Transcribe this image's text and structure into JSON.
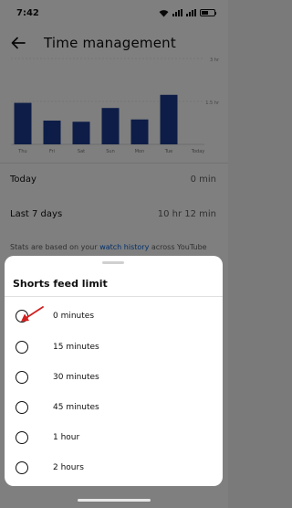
{
  "status_bar": {
    "time": "7:42",
    "icons": [
      "wifi-icon",
      "signal-icon",
      "signal-icon",
      "battery-icon"
    ]
  },
  "header": {
    "title": "Time management",
    "back_icon": "back-arrow-icon"
  },
  "chart_data": {
    "type": "bar",
    "categories": [
      "Thu",
      "Fri",
      "Sat",
      "Sun",
      "Mon",
      "Tue",
      "Today"
    ],
    "values": [
      1.45,
      0.83,
      0.79,
      1.27,
      0.87,
      1.73,
      0
    ],
    "ytick_labels": [
      "3 hr",
      "1.5 hr"
    ],
    "ylim": [
      0,
      3
    ],
    "grid": true,
    "color": "#1a3a8f"
  },
  "stats": {
    "today": {
      "label": "Today",
      "value": "0 min"
    },
    "last7": {
      "label": "Last 7 days",
      "value": "10 hr 12 min"
    }
  },
  "footnote": {
    "prefix": "Stats are based on your",
    "link": "watch history",
    "suffix": "across YouTube"
  },
  "sheet": {
    "title": "Shorts feed limit",
    "options": [
      "0 minutes",
      "15 minutes",
      "30 minutes",
      "45 minutes",
      "1 hour",
      "2 hours"
    ],
    "annotation_color": "#d21f1f"
  }
}
